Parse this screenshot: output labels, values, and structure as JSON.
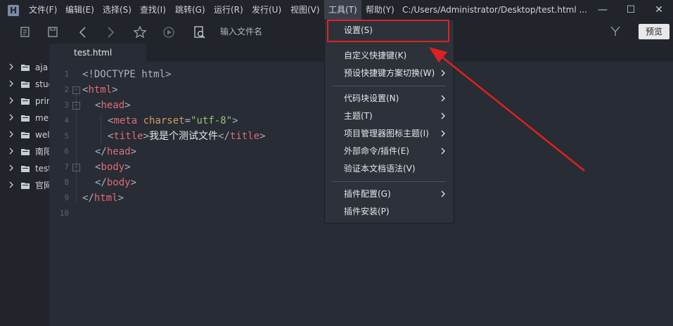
{
  "app": {
    "logo_letter": "H",
    "window_title": "C:/Users/Administrator/Desktop/test.html ...",
    "window_buttons": {
      "minimize": "—",
      "maximize": "☐",
      "close": "✕"
    }
  },
  "menu": {
    "items": [
      {
        "label": "文件(F)"
      },
      {
        "label": "编辑(E)"
      },
      {
        "label": "选择(S)"
      },
      {
        "label": "查找(I)"
      },
      {
        "label": "跳转(G)"
      },
      {
        "label": "运行(R)"
      },
      {
        "label": "发行(U)"
      },
      {
        "label": "视图(V)"
      },
      {
        "label": "工具(T)",
        "active": true
      },
      {
        "label": "帮助(Y)"
      }
    ]
  },
  "toolbar": {
    "search_placeholder": "输入文件名",
    "preview_label": "预览",
    "icons": [
      "new-file-icon",
      "save-icon",
      "back-icon",
      "forward-icon",
      "star-icon",
      "run-icon",
      "file-search-icon",
      "filter-icon"
    ]
  },
  "sidebar": {
    "items": [
      {
        "label": "aja"
      },
      {
        "label": "stud"
      },
      {
        "label": "prin"
      },
      {
        "label": "me"
      },
      {
        "label": "wel"
      },
      {
        "label": "南阳"
      },
      {
        "label": "test"
      },
      {
        "label": "官网"
      }
    ]
  },
  "tabs": [
    {
      "label": "test.html",
      "active": true
    }
  ],
  "editor": {
    "line_numbers": [
      "1",
      "2",
      "3",
      "4",
      "5",
      "6",
      "7",
      "8",
      "9",
      "10"
    ],
    "lines": {
      "l1": {
        "text": "<!DOCTYPE html>"
      },
      "l2": {
        "open": "<",
        "tag": "html",
        "close": ">"
      },
      "l3": {
        "open": "<",
        "tag": "head",
        "close": ">"
      },
      "l4": {
        "open": "<",
        "tag": "meta",
        "attr": "charset",
        "eq": "=",
        "value": "\"utf-8\"",
        "close": ">"
      },
      "l5": {
        "open": "<",
        "tag": "title",
        "close": ">",
        "text": "我是个测试文件",
        "open2": "</",
        "tag2": "title",
        "close2": ">"
      },
      "l6": {
        "open": "</",
        "tag": "head",
        "close": ">"
      },
      "l7": {
        "open": "<",
        "tag": "body",
        "close": ">"
      },
      "l8": {
        "open": "</",
        "tag": "body",
        "close": ">"
      },
      "l9": {
        "open": "</",
        "tag": "html",
        "close": ">"
      }
    }
  },
  "dropdown": {
    "items": [
      {
        "label": "设置(S)",
        "highlighted": true
      },
      {
        "label": "自定义快捷键(K)"
      },
      {
        "label": "预设快捷键方案切换(W)",
        "submenu": true
      },
      {
        "label": "代码块设置(N)",
        "submenu": true
      },
      {
        "label": "主题(T)",
        "submenu": true
      },
      {
        "label": "项目管理器图标主题(I)",
        "submenu": true
      },
      {
        "label": "外部命令/插件(E)",
        "submenu": true
      },
      {
        "label": "验证本文档语法(V)"
      },
      {
        "label": "插件配置(G)",
        "submenu": true
      },
      {
        "label": "插件安装(P)"
      }
    ]
  },
  "colors": {
    "background": "#282c34",
    "chrome": "#21252b",
    "menu_bg": "#2c313a",
    "tag": "#e06c75",
    "attr": "#d19a66",
    "string": "#98c379",
    "annotation_red": "#e02020"
  }
}
